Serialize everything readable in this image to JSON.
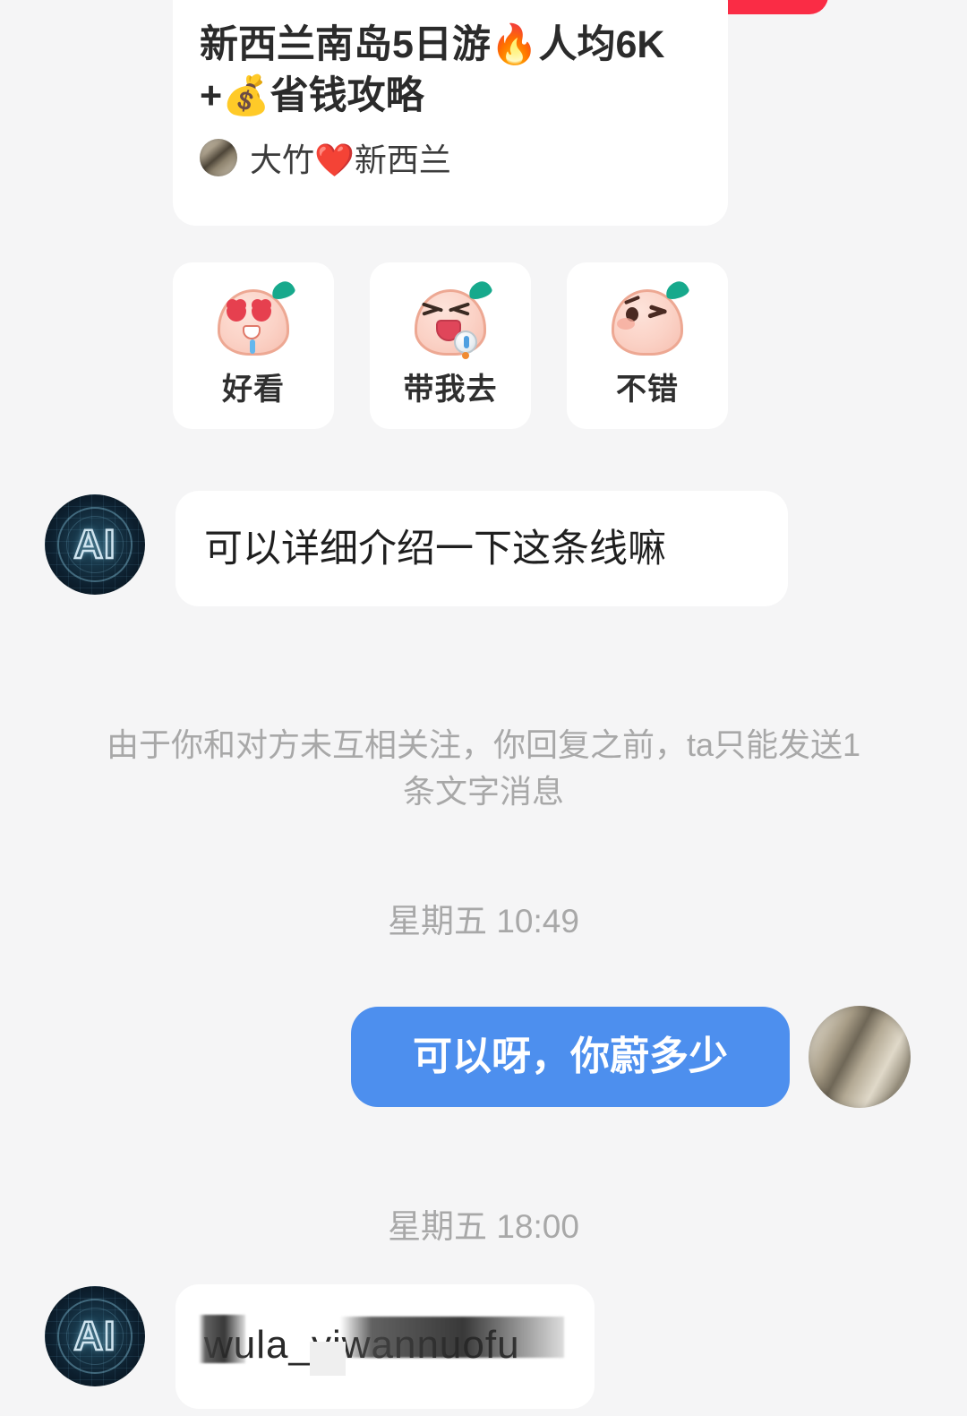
{
  "app": {
    "background_color": "#f5f5f6",
    "accent_blue": "#4d8fee",
    "accent_red": "#fa2c45"
  },
  "shared_card": {
    "title": "新西兰南岛5日游🔥人均6K+💰省钱攻略",
    "author_name": "大竹❤️新西兰",
    "avatar_icon": "author-photo-avatar"
  },
  "quick_stickers": [
    {
      "label": "好看",
      "icon": "peach-heart-eyes-sticker"
    },
    {
      "label": "带我去",
      "icon": "peach-laughing-mic-sticker"
    },
    {
      "label": "不错",
      "icon": "peach-winking-sticker"
    }
  ],
  "messages": [
    {
      "id": "msg-incoming-1",
      "side": "incoming",
      "avatar_icon": "ai-avatar",
      "avatar_label": "AI",
      "text": "可以详细介绍一下这条线嘛"
    },
    {
      "id": "msg-outgoing-1",
      "side": "outgoing",
      "avatar_icon": "user-photo-avatar",
      "text": "可以呀，你蔚多少"
    },
    {
      "id": "msg-incoming-2",
      "side": "incoming",
      "avatar_icon": "ai-avatar",
      "avatar_label": "AI",
      "text": "wula_yiwannuofu",
      "redacted": true
    }
  ],
  "system_notice": "由于你和对方未互相关注，你回复之前，ta只能发送1条文字消息",
  "timestamps": [
    {
      "id": "ts-1",
      "text": "星期五 10:49"
    },
    {
      "id": "ts-2",
      "text": "星期五 18:00"
    }
  ]
}
